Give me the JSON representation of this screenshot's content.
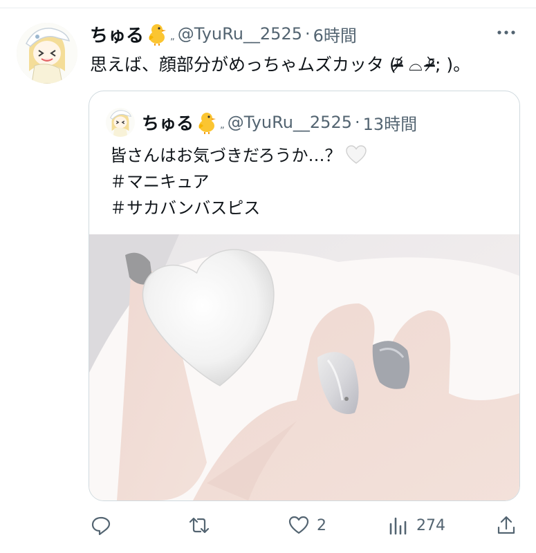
{
  "tweet": {
    "author_name": "ちゅる",
    "author_handle": "@TyuRu__2525",
    "separator": "·",
    "time": "6時間",
    "text": "思えば、顔部分がめっちゃムズカッタ (ᵒ̴̶̷᷄ ⌓ ᵒ̴̶̷᷅; )。",
    "mark": "„"
  },
  "quote": {
    "author_name": "ちゅる",
    "author_handle": "@TyuRu__2525",
    "separator": "·",
    "time": "13時間",
    "lines": [
      "皆さんはお気づきだろうか…？",
      "＃マニキュア",
      "＃サカバンバスピス"
    ],
    "emoji": "white-heart"
  },
  "actions": {
    "reply": {
      "icon": "reply-icon",
      "count": ""
    },
    "retweet": {
      "icon": "retweet-icon",
      "count": ""
    },
    "like": {
      "icon": "heart-icon",
      "count": "2"
    },
    "views": {
      "icon": "views-icon",
      "count": "274"
    },
    "share": {
      "icon": "share-icon",
      "count": ""
    }
  },
  "colors": {
    "text": "#0f1419",
    "secondary": "#536471",
    "border": "#cfd9de"
  }
}
